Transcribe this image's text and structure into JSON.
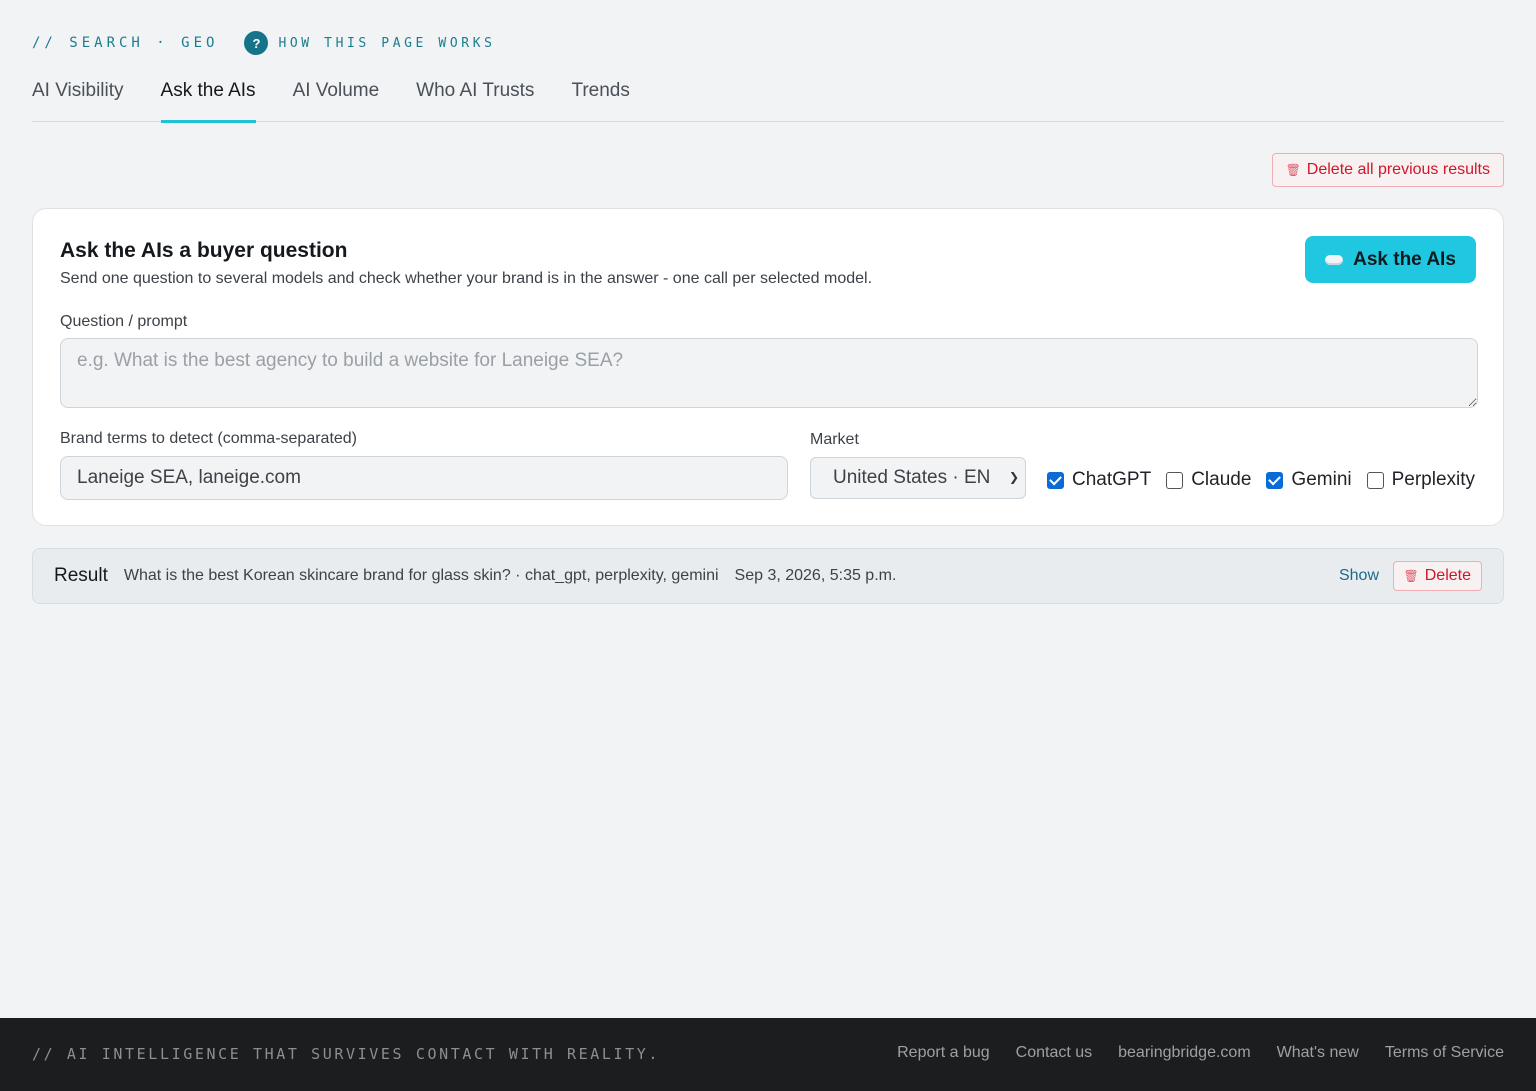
{
  "header": {
    "breadcrumb": "// SEARCH · GEO",
    "help_badge": "?",
    "help_label": "HOW THIS PAGE WORKS"
  },
  "tabs": [
    {
      "label": "AI Visibility",
      "active": false
    },
    {
      "label": "Ask the AIs",
      "active": true
    },
    {
      "label": "AI Volume",
      "active": false
    },
    {
      "label": "Who AI Trusts",
      "active": false
    },
    {
      "label": "Trends",
      "active": false
    }
  ],
  "actions": {
    "delete_all_label": "Delete all previous results"
  },
  "card": {
    "title": "Ask the AIs a buyer question",
    "subtitle": "Send one question to several models and check whether your brand is in the answer - one call per selected model.",
    "ask_button_label": "Ask the AIs",
    "prompt_label": "Question / prompt",
    "prompt_placeholder": "e.g. What is the best agency to build a website for Laneige SEA?",
    "prompt_value": "",
    "brand_label": "Brand terms to detect (comma-separated)",
    "brand_value": "Laneige SEA, laneige.com",
    "market_label": "Market",
    "market_value": "United States · EN",
    "models": [
      {
        "label": "ChatGPT",
        "checked": true
      },
      {
        "label": "Claude",
        "checked": false
      },
      {
        "label": "Gemini",
        "checked": true
      },
      {
        "label": "Perplexity",
        "checked": false
      }
    ]
  },
  "result": {
    "label": "Result",
    "summary": "What is the best Korean skincare brand for glass skin? · chat_gpt, perplexity, gemini",
    "date": "Sep 3, 2026, 5:35 p.m.",
    "show_label": "Show",
    "delete_label": "Delete"
  },
  "footer": {
    "tagline": "// AI INTELLIGENCE THAT SURVIVES CONTACT WITH REALITY.",
    "links": [
      "Report a bug",
      "Contact us",
      "bearingbridge.com",
      "What's new",
      "Terms of Service"
    ]
  },
  "colors": {
    "accent": "#1fc8e0",
    "danger": "#d0172a",
    "mono_accent": "#1c7d8f",
    "footer_bg": "#1b1d1f"
  }
}
